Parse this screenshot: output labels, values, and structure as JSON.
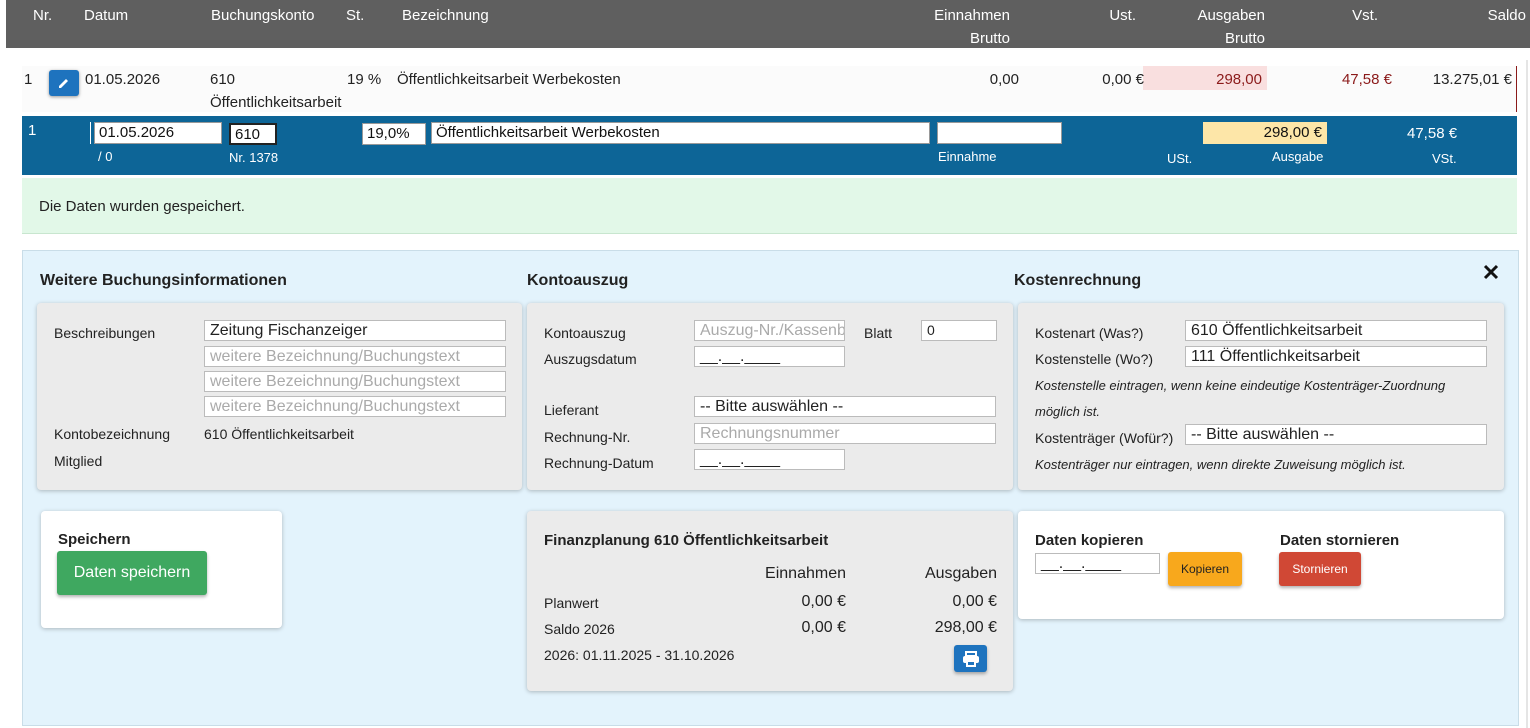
{
  "header": {
    "nr": "Nr.",
    "datum": "Datum",
    "buchungskonto": "Buchungskonto",
    "st": "St.",
    "bezeichnung": "Bezeichnung",
    "einnahmen_1": "Einnahmen",
    "einnahmen_2": "Brutto",
    "ust": "Ust.",
    "ausgaben_1": "Ausgaben",
    "ausgaben_2": "Brutto",
    "vst": "Vst.",
    "saldo": "Saldo"
  },
  "row": {
    "nr": "1",
    "datum": "01.05.2026",
    "konto_nr": "610",
    "konto_name": "Öffentlichkeitsarbeit",
    "st": "19 %",
    "bezeichnung": "Öffentlichkeitsarbeit Werbekosten",
    "einnahmen": "0,00",
    "ust": "0,00 €",
    "ausgaben": "298,00",
    "vst": "47,58 €",
    "saldo": "13.275,01 €"
  },
  "edit": {
    "nr": "1",
    "datum": "01.05.2026",
    "sub_datum": "/ 0",
    "konto": "610",
    "konto_nr_label": "Nr. 1378",
    "steuersatz": "19,0%",
    "bezeichnung": "Öffentlichkeitsarbeit Werbekosten",
    "einnahme": "",
    "einnahme_label": "Einnahme",
    "ust_label": "USt.",
    "ausgabe": "298,00 €",
    "ausgabe_label": "Ausgabe",
    "vst": "47,58 €",
    "vst_label": "VSt."
  },
  "message": "Die Daten wurden gespeichert.",
  "weitere": {
    "title": "Weitere Buchungsinformationen",
    "beschreibungen_label": "Beschreibungen",
    "beschreibung_1": "Zeitung Fischanzeiger",
    "beschreibung_placeholder": "weitere Bezeichnung/Buchungstext",
    "kontobezeichnung_label": "Kontobezeichnung",
    "kontobezeichnung": "610 Öffentlichkeitsarbeit",
    "mitglied_label": "Mitglied"
  },
  "kontoauszug": {
    "title": "Kontoauszug",
    "kontoauszug_label": "Kontoauszug",
    "kontoauszug_placeholder": "Auszug-Nr./Kassenb",
    "blatt_label": "Blatt",
    "blatt": "0",
    "auszugsdatum_label": "Auszugsdatum",
    "date_placeholder": "__.__.____",
    "lieferant_label": "Lieferant",
    "lieferant": "-- Bitte auswählen --",
    "rechnung_nr_label": "Rechnung-Nr.",
    "rechnung_nr_placeholder": "Rechnungsnummer",
    "rechnung_datum_label": "Rechnung-Datum"
  },
  "kosten": {
    "title": "Kostenrechnung",
    "kostenart_label": "Kostenart (Was?)",
    "kostenart": "610 Öffentlichkeitsarbeit",
    "kostenstelle_label": "Kostenstelle (Wo?)",
    "kostenstelle": "111 Öffentlichkeitsarbeit",
    "note1a": "Kostenstelle eintragen, wenn keine eindeutige Kostenträger-Zuordnung",
    "note1b": "möglich ist.",
    "kostentraeger_label": "Kostenträger (Wofür?)",
    "kostentraeger": "-- Bitte auswählen --",
    "note2": "Kostenträger nur eintragen, wenn direkte Zuweisung möglich ist."
  },
  "speichern": {
    "title": "Speichern",
    "button": "Daten speichern"
  },
  "finanz": {
    "title": "Finanzplanung 610 Öffentlichkeitsarbeit",
    "col_einnahmen": "Einnahmen",
    "col_ausgaben": "Ausgaben",
    "planwert_label": "Planwert",
    "planwert_ein": "0,00 €",
    "planwert_aus": "0,00 €",
    "saldo_label": "Saldo 2026",
    "saldo_ein": "0,00 €",
    "saldo_aus": "298,00 €",
    "zeitraum": "2026: 01.11.2025 - 31.10.2026"
  },
  "kopieren": {
    "title": "Daten kopieren",
    "date_placeholder": "__.__.____",
    "button": "Kopieren"
  },
  "stornieren": {
    "title": "Daten stornieren",
    "button": "Stornieren"
  },
  "colors": {
    "header_bg": "#5f5f5f",
    "edit_row_bg": "#0d6597",
    "success_bg": "#e2f8e8",
    "panel_bg": "#e3f3fc",
    "save_green": "#3fa860",
    "copy_orange": "#f8a81c",
    "storno_red": "#d04835",
    "edit_blue": "#1e73be"
  }
}
